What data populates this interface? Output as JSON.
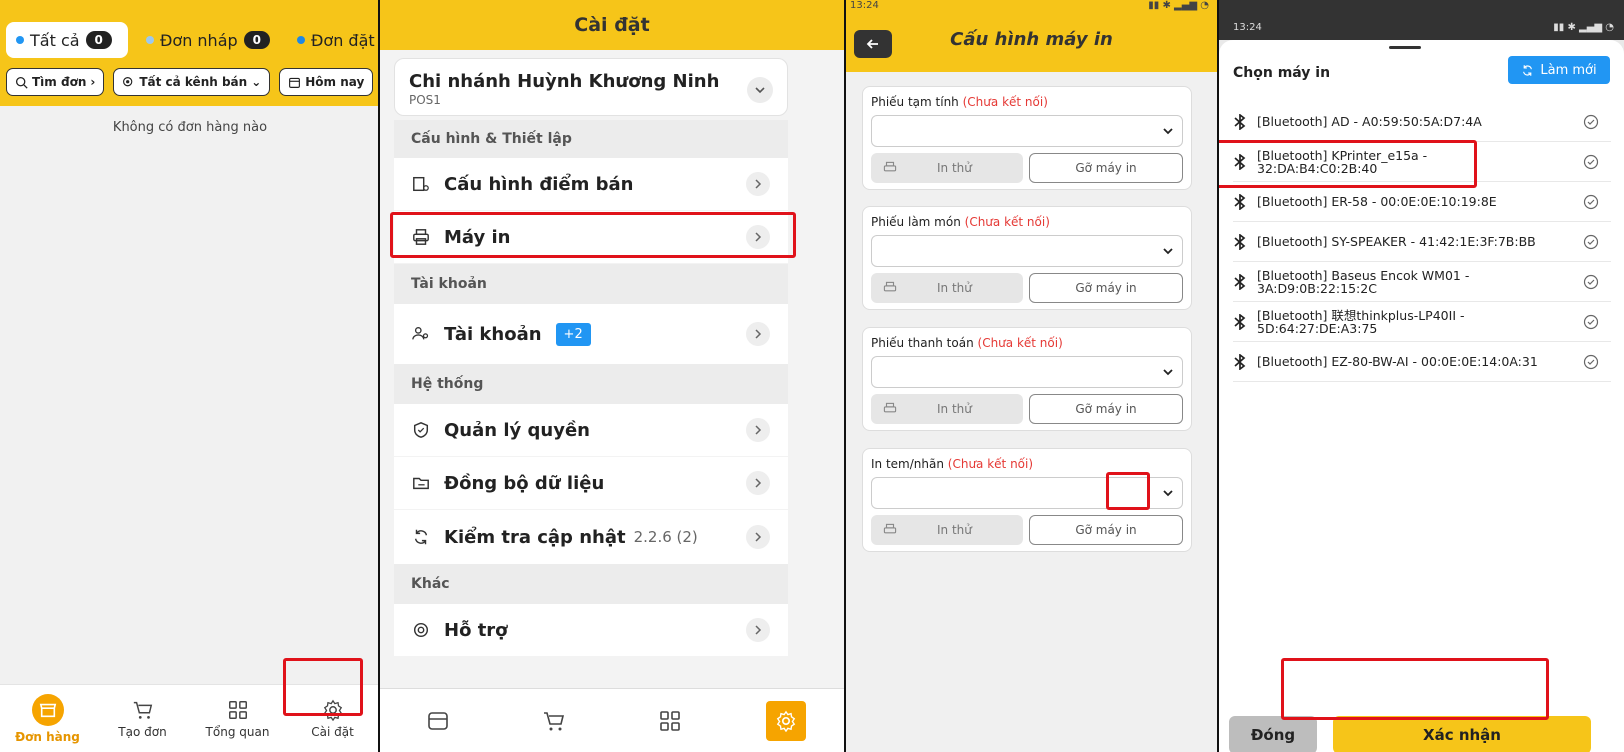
{
  "colors": {
    "accent": "#f6c519",
    "highlight": "#e0121a",
    "link_blue": "#2196f3",
    "warning_red": "#e53935"
  },
  "orders": {
    "tabs": [
      {
        "label": "Tất cả",
        "count": "0",
        "dot": "#2196f3"
      },
      {
        "label": "Đơn nháp",
        "count": "0",
        "dot": "#1e88e5"
      },
      {
        "label": "Đơn đặt",
        "dot": "#1e88e5"
      }
    ],
    "filters": {
      "search": "Tìm đơn",
      "channel": "Tất cả kênh bán",
      "date": "Hôm nay"
    },
    "empty_text": "Không có đơn hàng nào",
    "nav": [
      "Đơn hàng",
      "Tạo đơn",
      "Tổng quan",
      "Cài đặt"
    ]
  },
  "settings": {
    "title": "Cài đặt",
    "branch_name": "Chi nhánh Huỳnh Khương Ninh",
    "branch_sub": "POS1",
    "sec_config": "Cấu hình & Thiết lập",
    "pos_config": "Cấu hình điểm bán",
    "printer": "Máy in",
    "sec_account": "Tài khoản",
    "account": "Tài khoản",
    "account_badge": "+2",
    "sec_system": "Hệ thống",
    "permissions": "Quản lý quyền",
    "sync": "Đồng bộ dữ liệu",
    "update": "Kiểm tra cập nhật",
    "version": "2.2.6 (2)",
    "sec_other": "Khác",
    "support": "Hỗ trợ"
  },
  "printer_config": {
    "time": "13:24",
    "title": "Cấu hình máy in",
    "not_connected": "(Chưa kết nối)",
    "test_label": "In thử",
    "remove_label": "Gỡ máy in",
    "slips": [
      "Phiếu tạm tính",
      "Phiếu làm món",
      "Phiếu thanh toán",
      "In tem/nhãn"
    ]
  },
  "choose_printer": {
    "time": "13:24",
    "title": "Chọn máy in",
    "refresh": "Làm mới",
    "devices": [
      "[Bluetooth] AD - A0:59:50:5A:D7:4A",
      "[Bluetooth] KPrinter_e15a - 32:DA:B4:C0:2B:40",
      "[Bluetooth] ER-58 - 00:0E:0E:10:19:8E",
      "[Bluetooth] SY-SPEAKER - 41:42:1E:3F:7B:BB",
      "[Bluetooth] Baseus Encok WM01 - 3A:D9:0B:22:15:2C",
      "[Bluetooth] 联想thinkplus-LP40II - 5D:64:27:DE:A3:75",
      "[Bluetooth] EZ-80-BW-AI - 00:0E:0E:14:0A:31"
    ],
    "close": "Đóng",
    "confirm": "Xác nhận"
  }
}
